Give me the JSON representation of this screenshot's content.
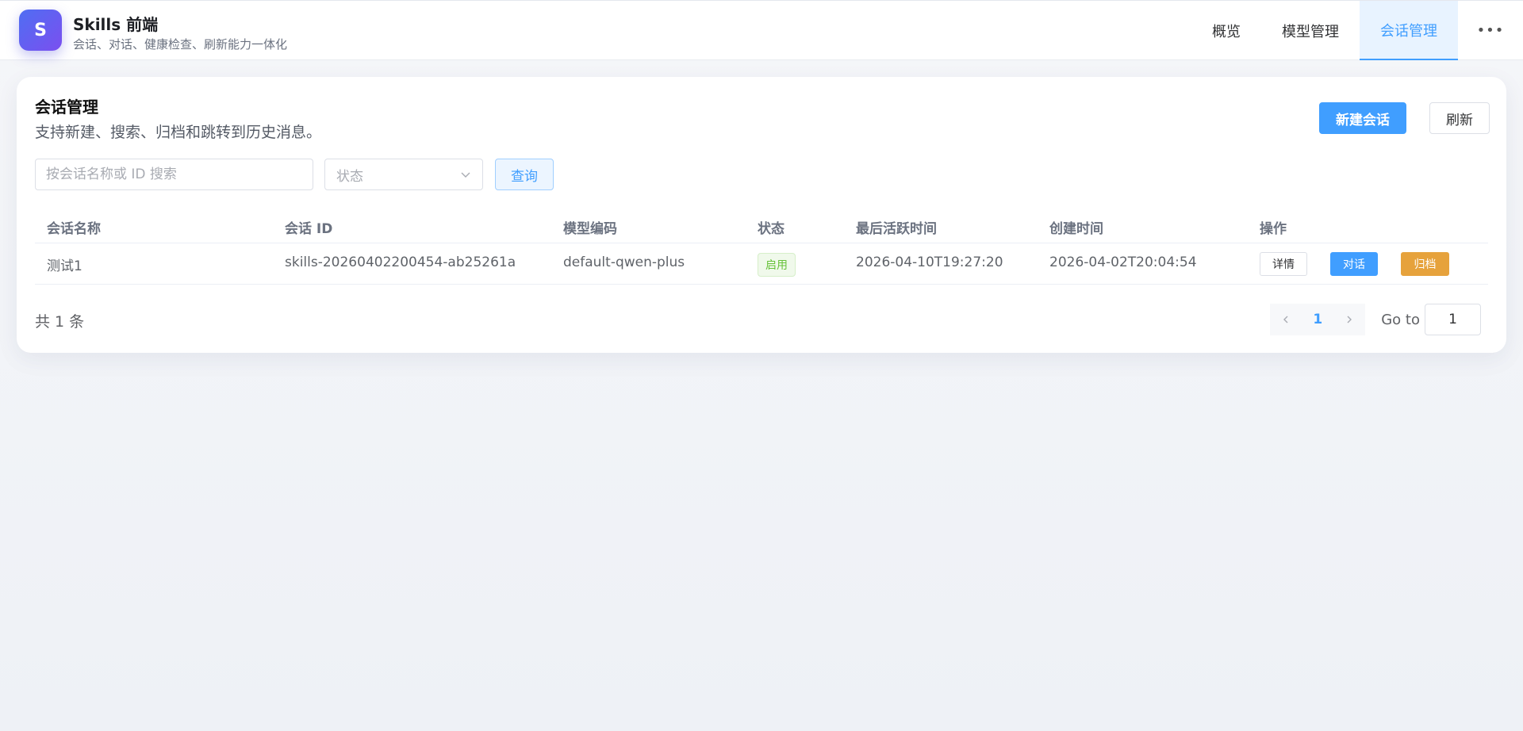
{
  "app": {
    "logo_letter": "S",
    "title": "Skills 前端",
    "subtitle": "会话、对话、健康检查、刷新能力一体化"
  },
  "nav": {
    "items": [
      {
        "label": "概览",
        "active": false
      },
      {
        "label": "模型管理",
        "active": false
      },
      {
        "label": "会话管理",
        "active": true
      }
    ],
    "more": "•••"
  },
  "page": {
    "title": "会话管理",
    "description": "支持新建、搜索、归档和跳转到历史消息。",
    "new_button": "新建会话",
    "refresh_button": "刷新"
  },
  "filters": {
    "search_placeholder": "按会话名称或 ID 搜索",
    "search_value": "",
    "status_placeholder": "状态",
    "query_button": "查询"
  },
  "table": {
    "headers": [
      "会话名称",
      "会话 ID",
      "模型编码",
      "状态",
      "最后活跃时间",
      "创建时间",
      "操作"
    ],
    "rows": [
      {
        "name": "测试1",
        "id": "skills-20260402200454-ab25261a",
        "model": "default-qwen-plus",
        "status": "启用",
        "last_active": "2026-04-10T19:27:20",
        "created": "2026-04-02T20:04:54",
        "actions": {
          "detail": "详情",
          "chat": "对话",
          "archive": "归档"
        }
      }
    ]
  },
  "pagination": {
    "total_text": "共 1 条",
    "current_page": "1",
    "goto_label": "Go to",
    "goto_value": "1"
  },
  "colors": {
    "primary": "#409eff",
    "success": "#67c23a",
    "warning": "#e6a23c"
  }
}
